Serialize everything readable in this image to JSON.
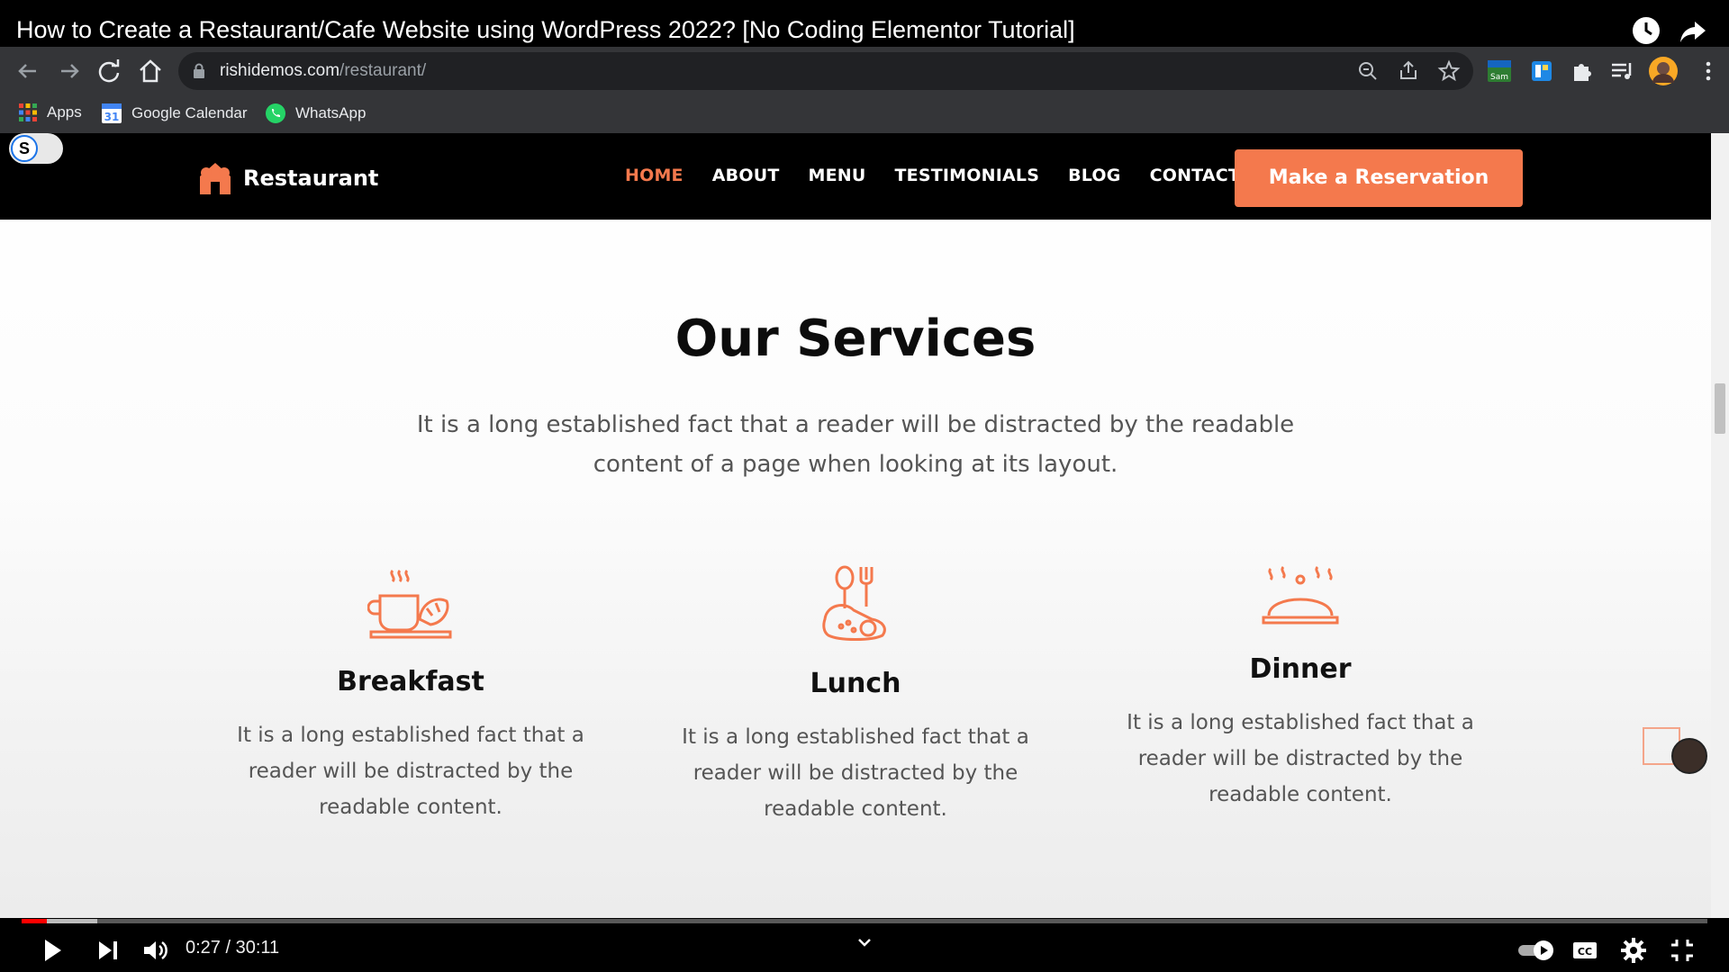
{
  "video": {
    "title": "How to Create a Restaurant/Cafe Website using WordPress 2022? [No Coding Elementor Tutorial]",
    "time": "0:27 / 30:11",
    "progress_played": 0.015,
    "progress_buffered": 0.045
  },
  "browser": {
    "url_domain": "rishidemos.com",
    "url_path": "/restaurant/",
    "bookmarks": [
      {
        "label": "Apps"
      },
      {
        "label": "Google Calendar"
      },
      {
        "label": "WhatsApp"
      }
    ],
    "extension_badge": "Sam"
  },
  "site": {
    "toggle_letter": "S",
    "logo_text": "Restaurant",
    "menu": [
      {
        "label": "HOME",
        "active": true
      },
      {
        "label": "ABOUT",
        "active": false
      },
      {
        "label": "MENU",
        "active": false
      },
      {
        "label": "TESTIMONIALS",
        "active": false
      },
      {
        "label": "BLOG",
        "active": false
      },
      {
        "label": "CONTACT",
        "active": false
      }
    ],
    "cta_label": "Make a Reservation",
    "accent_color": "#f4794d"
  },
  "services": {
    "title": "Our Services",
    "subtitle": "It is a long established fact that a reader will be distracted by the readable content of a page when looking at its layout.",
    "items": [
      {
        "name": "Breakfast",
        "icon": "coffee-croissant-icon",
        "text": "It is a long established fact that a reader will be distracted by the readable content."
      },
      {
        "name": "Lunch",
        "icon": "plate-fork-spoon-icon",
        "text": "It is a long established fact that a reader will be distracted by the readable content."
      },
      {
        "name": "Dinner",
        "icon": "cloche-icon",
        "text": "It is a long established fact that a reader will be distracted by the readable content."
      }
    ]
  }
}
